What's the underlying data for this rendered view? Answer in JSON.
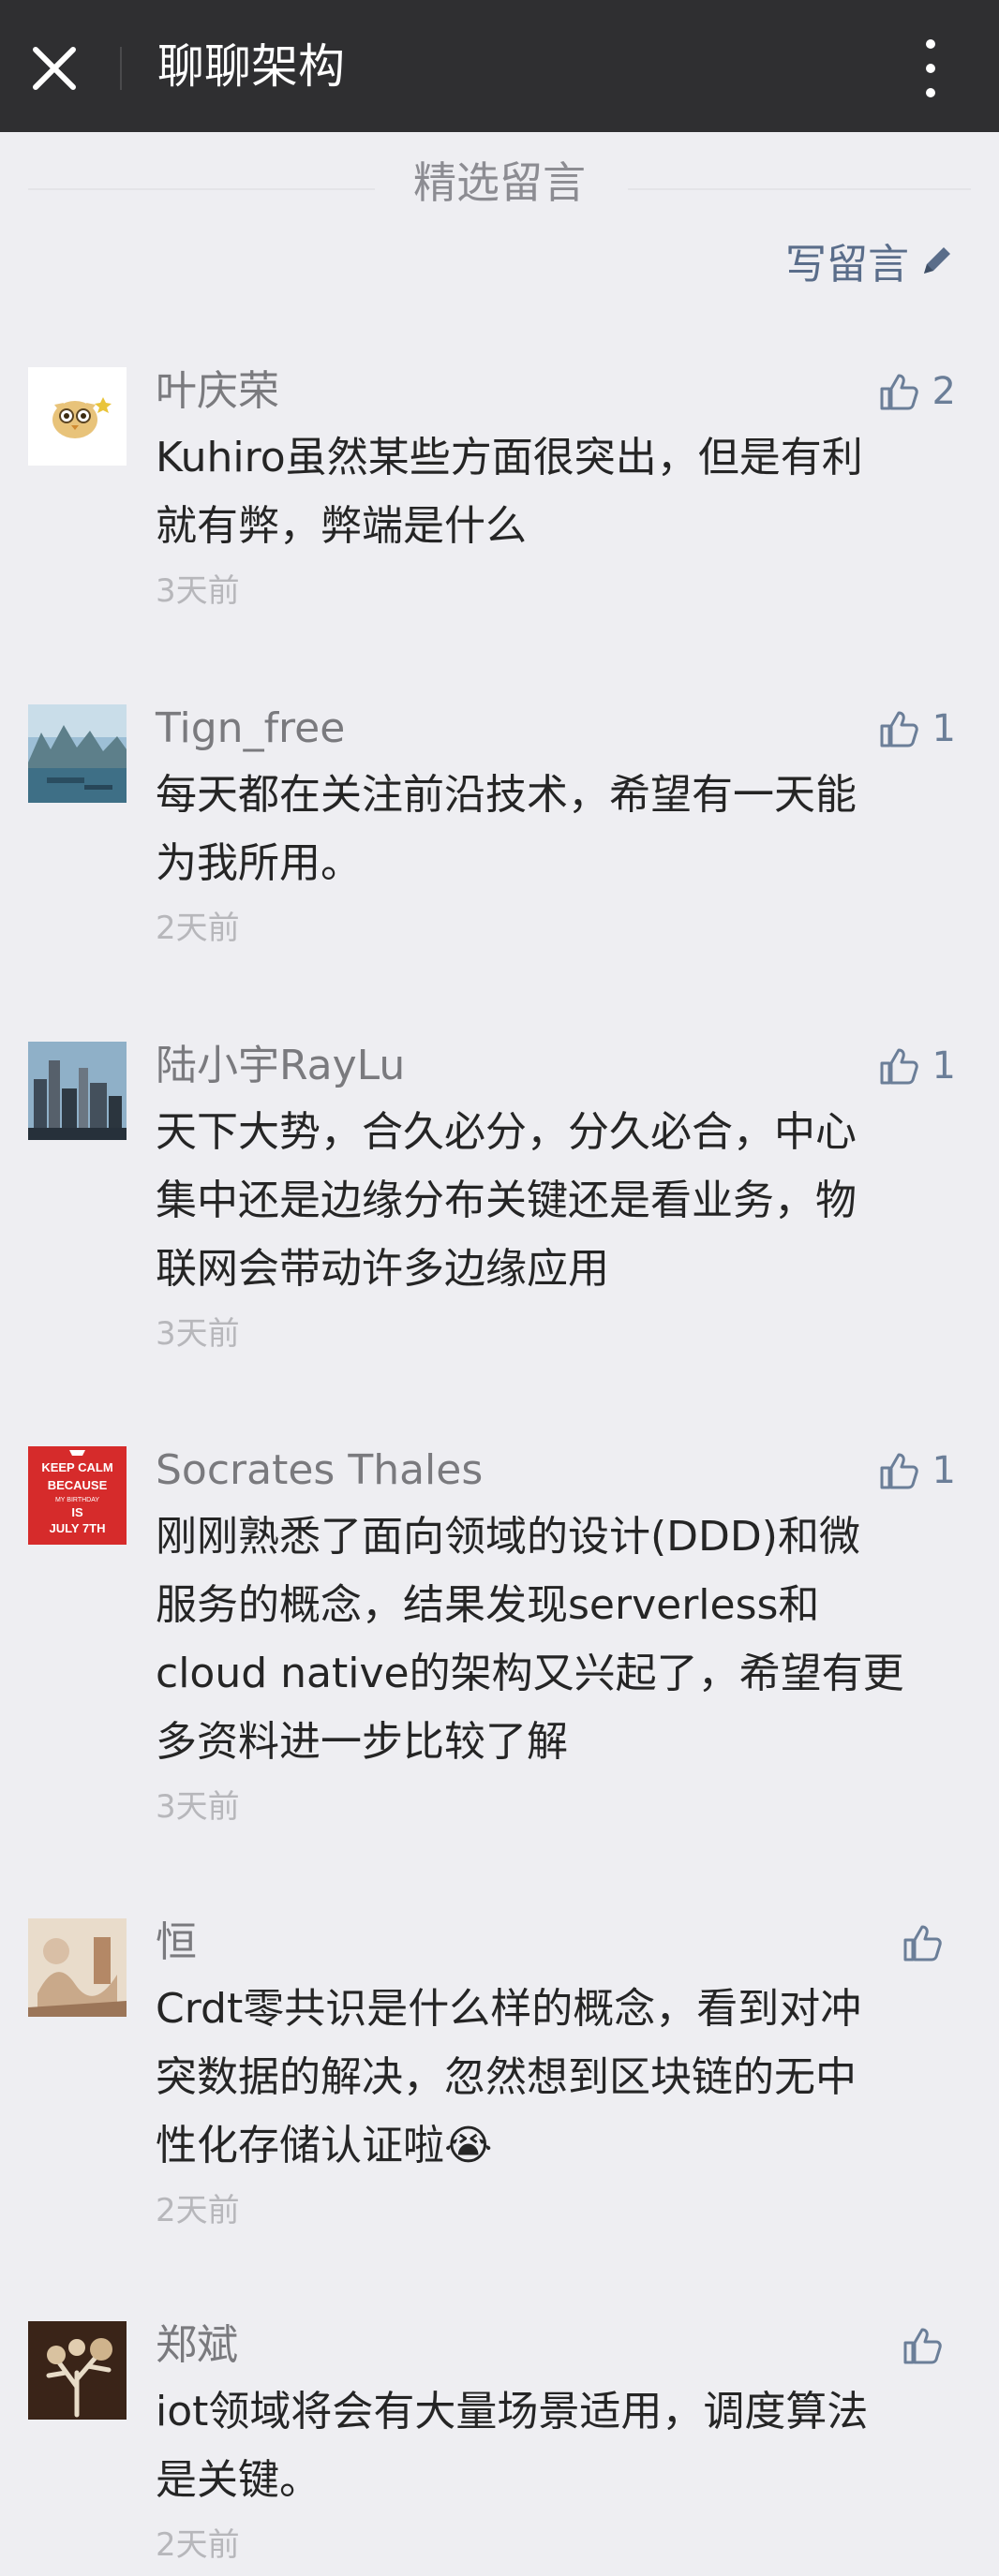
{
  "header": {
    "title": "聊聊架构",
    "close_icon": "close-icon",
    "more_icon": "more-vertical-icon"
  },
  "section": {
    "title": "精选留言",
    "write_label": "写留言",
    "write_icon": "pencil-icon"
  },
  "comments": [
    {
      "name": "叶庆荣",
      "likes": "2",
      "text_lines": [
        "Kuhiro虽然某些方面很突出，但是有利",
        "就有弊，弊端是什么"
      ],
      "time": "3天前",
      "avatar": "cartoon-owl-avatar"
    },
    {
      "name": "Tign_free",
      "likes": "1",
      "text_lines": [
        "每天都在关注前沿技术，希望有一天能",
        "为我所用。"
      ],
      "time": "2天前",
      "avatar": "lake-landscape-avatar"
    },
    {
      "name": "陆小宇RayLu",
      "likes": "1",
      "text_lines": [
        "天下大势，合久必分，分久必合，中心",
        "集中还是边缘分布关键还是看业务，物",
        "联网会带动许多边缘应用"
      ],
      "time": "3天前",
      "avatar": "city-skyline-avatar"
    },
    {
      "name": "Socrates Thales",
      "likes": "1",
      "text_lines": [
        "刚刚熟悉了面向领域的设计(DDD)和微",
        "服务的概念，结果发现serverless和",
        "cloud native的架构又兴起了，希望有更",
        "多资料进一步比较了解"
      ],
      "time": "3天前",
      "avatar": "keep-calm-poster-avatar",
      "avatar_text": [
        "KEEP CALM",
        "BECAUSE",
        "MY BIRTHDAY",
        "IS",
        "JULY 7TH"
      ]
    },
    {
      "name": "恒",
      "likes": "",
      "text_lines": [
        "Crdt零共识是什么样的概念，看到对冲",
        "突数据的解决，忽然想到区块链的无中",
        "性化存储认证啦😭"
      ],
      "time": "2天前",
      "avatar": "painting-avatar"
    },
    {
      "name": "郑斌",
      "likes": "",
      "text_lines": [
        "iot领域将会有大量场景适用，调度算法",
        "是关键。"
      ],
      "time": "2天前",
      "avatar": "tree-art-avatar"
    }
  ],
  "colors": {
    "topbar": "#2f2f31",
    "background": "#eeeef2",
    "link": "#5a6d8a",
    "text": "#252525"
  }
}
